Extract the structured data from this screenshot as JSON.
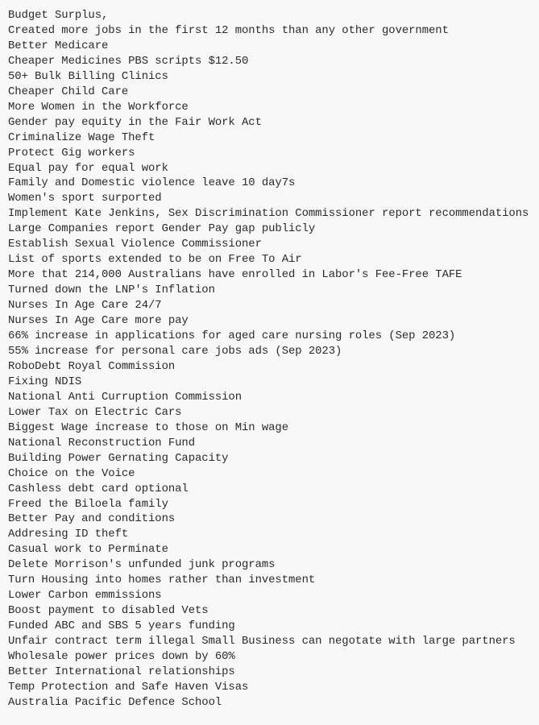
{
  "document": {
    "lines": [
      "Budget Surplus,",
      "Created more jobs in the first 12 months than any other government",
      "Better Medicare",
      "Cheaper Medicines PBS scripts $12.50",
      "50+ Bulk Billing Clinics",
      "Cheaper Child Care",
      "More Women in the Workforce",
      "Gender pay equity in the Fair Work Act",
      "Criminalize Wage Theft",
      "Protect Gig workers",
      "Equal pay for equal work",
      "Family and Domestic violence leave 10 day7s",
      "Women's sport surported",
      "Implement Kate Jenkins, Sex Discrimination Commissioner report recommendations",
      "Large Companies report Gender Pay gap publicly",
      "Establish Sexual Violence Commissioner",
      "List of sports extended to be on Free To Air",
      "More that 214,000 Australians have enrolled in Labor's Fee-Free TAFE",
      "Turned down the LNP's Inflation",
      "Nurses In Age Care 24/7",
      "Nurses In Age Care more pay",
      "66% increase in applications for aged care nursing roles (Sep 2023)",
      "55% increase for personal care jobs ads (Sep 2023)",
      "RoboDebt Royal Commission",
      "Fixing NDIS",
      "National Anti Curruption Commission",
      "Lower Tax on Electric Cars",
      "Biggest Wage increase to those on Min wage",
      "National Reconstruction Fund",
      "Building Power Gernating Capacity",
      "Choice on the Voice",
      "Cashless debt card optional",
      "Freed the Biloela family",
      "Better Pay and conditions",
      "Addresing ID theft",
      "Casual work to Perminate",
      "Delete Morrison's unfunded junk programs",
      "Turn Housing into homes rather than investment",
      "Lower Carbon emmissions",
      "Boost payment to disabled Vets",
      "Funded ABC and SBS 5 years funding",
      "Unfair contract term illegal Small Business can negotate with large partners",
      "Wholesale power prices down by 60%",
      "Better International relationships",
      "Temp Protection and Safe Haven Visas",
      "Australia Pacific Defence School"
    ]
  },
  "colors": {
    "background": "#f8f8f8",
    "text": "#2a2a2a"
  }
}
